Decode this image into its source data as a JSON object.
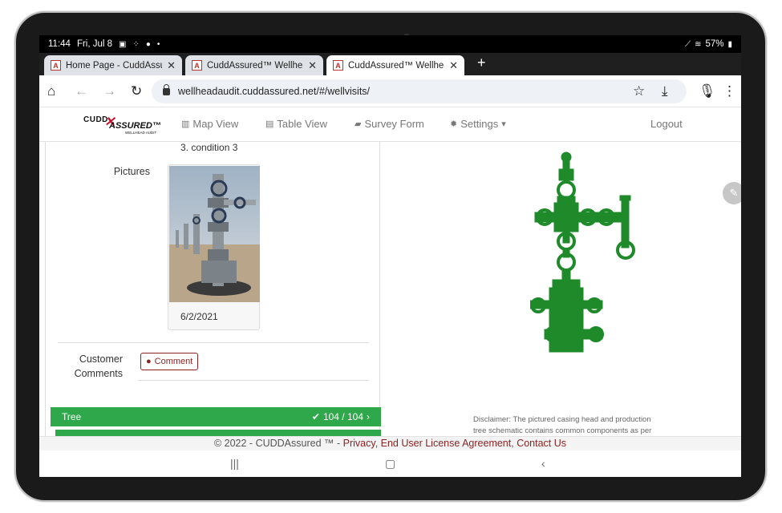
{
  "status_bar": {
    "time": "11:44",
    "date": "Fri, Jul 8",
    "battery": "57%",
    "icons": [
      "gallery-icon",
      "grid-icon",
      "bulb-icon",
      "dot-icon",
      "pen-icon",
      "wifi-icon",
      "battery-icon"
    ]
  },
  "tabs": [
    {
      "title": "Home Page - CuddAssured.n",
      "active": false
    },
    {
      "title": "CuddAssured™ Wellhead Aud",
      "active": false
    },
    {
      "title": "CuddAssured™ Wellhead Aud",
      "active": true
    }
  ],
  "url_bar": {
    "url": "wellheadaudit.cuddassured.net/#/wellvisits/"
  },
  "app_nav": {
    "logo_top": "CUDD",
    "logo_main": "ASSURED™",
    "logo_sub": "WELLHEAD AUDIT",
    "items": [
      {
        "label": "Map View",
        "icon": "map-icon"
      },
      {
        "label": "Table View",
        "icon": "table-icon"
      },
      {
        "label": "Survey Form",
        "icon": "book-icon"
      },
      {
        "label": "Settings",
        "icon": "gear-icon"
      }
    ],
    "logout": "Logout"
  },
  "detail": {
    "condition_text": "3. condition 3",
    "pictures_label": "Pictures",
    "photo_date": "6/2/2021",
    "customer_label_1": "Customer",
    "customer_label_2": "Comments",
    "comment_button": "Comment"
  },
  "tree_bar": {
    "label": "Tree",
    "count": "104 / 104"
  },
  "disclaimer": "Disclaimer: The pictured casing head and production tree schematic contains common components as per",
  "footer": {
    "copyright": "© 2022 - CUDDAssured ™ - ",
    "links": [
      "Privacy",
      "End User License Agreement",
      "Contact Us"
    ]
  },
  "colors": {
    "brand_red": "#8b2323",
    "tree_green": "#2ea84a",
    "schematic_green": "#1e8a2a"
  }
}
